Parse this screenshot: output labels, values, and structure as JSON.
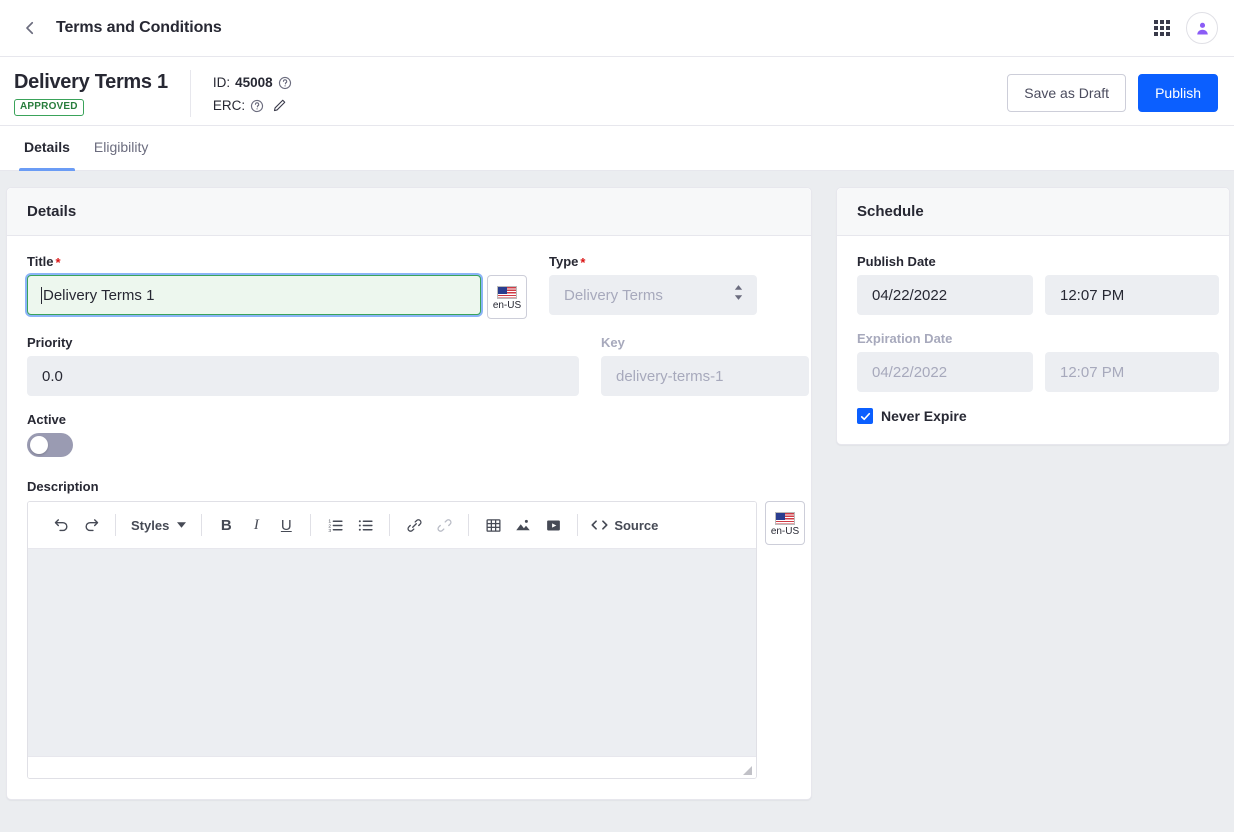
{
  "topbar": {
    "back_label": "back-arrow",
    "title": "Terms and Conditions",
    "apps_icon": "grid-apps-icon",
    "avatar_icon": "user-avatar-icon"
  },
  "header": {
    "doc_title": "Delivery Terms 1",
    "status_badge": "APPROVED",
    "id_label": "ID:",
    "id_value": "45008",
    "erc_label": "ERC:",
    "save_draft_label": "Save as Draft",
    "publish_label": "Publish"
  },
  "tabs": [
    {
      "label": "Details",
      "active": true
    },
    {
      "label": "Eligibility",
      "active": false
    }
  ],
  "details": {
    "card_title": "Details",
    "title_label": "Title",
    "title_value": "Delivery Terms 1",
    "title_lang": "en-US",
    "type_label": "Type",
    "type_value": "Delivery Terms",
    "priority_label": "Priority",
    "priority_value": "0.0",
    "key_label": "Key",
    "key_value": "delivery-terms-1",
    "active_label": "Active",
    "active_state": "off",
    "description_label": "Description",
    "description_lang": "en-US",
    "description_value": ""
  },
  "editor_toolbar": {
    "undo": "undo-icon",
    "redo": "redo-icon",
    "styles_label": "Styles",
    "bold": "B",
    "italic": "I",
    "underline": "U",
    "ordered_list": "ordered-list-icon",
    "unordered_list": "unordered-list-icon",
    "link": "link-icon",
    "unlink": "unlink-icon",
    "table": "table-icon",
    "image": "image-icon",
    "video": "video-icon",
    "source_label": "Source"
  },
  "schedule": {
    "card_title": "Schedule",
    "publish_date_label": "Publish Date",
    "publish_date_value": "04/22/2022",
    "publish_time_value": "12:07 PM",
    "expiration_date_label": "Expiration Date",
    "expiration_date_value": "04/22/2022",
    "expiration_time_value": "12:07 PM",
    "never_expire_label": "Never Expire",
    "never_expire_checked": true
  },
  "colors": {
    "primary": "#0b5fff",
    "approved_green": "#287d3c",
    "required_red": "#da1414",
    "tab_underline": "#6b9cf5",
    "page_bg": "#ebedf0",
    "field_bg": "#eceef2",
    "focus_ring": "#8bb4f7",
    "valid_border": "#3aa35a",
    "valid_bg": "#edf7ee",
    "avatar_purple": "#8b5cf6"
  }
}
